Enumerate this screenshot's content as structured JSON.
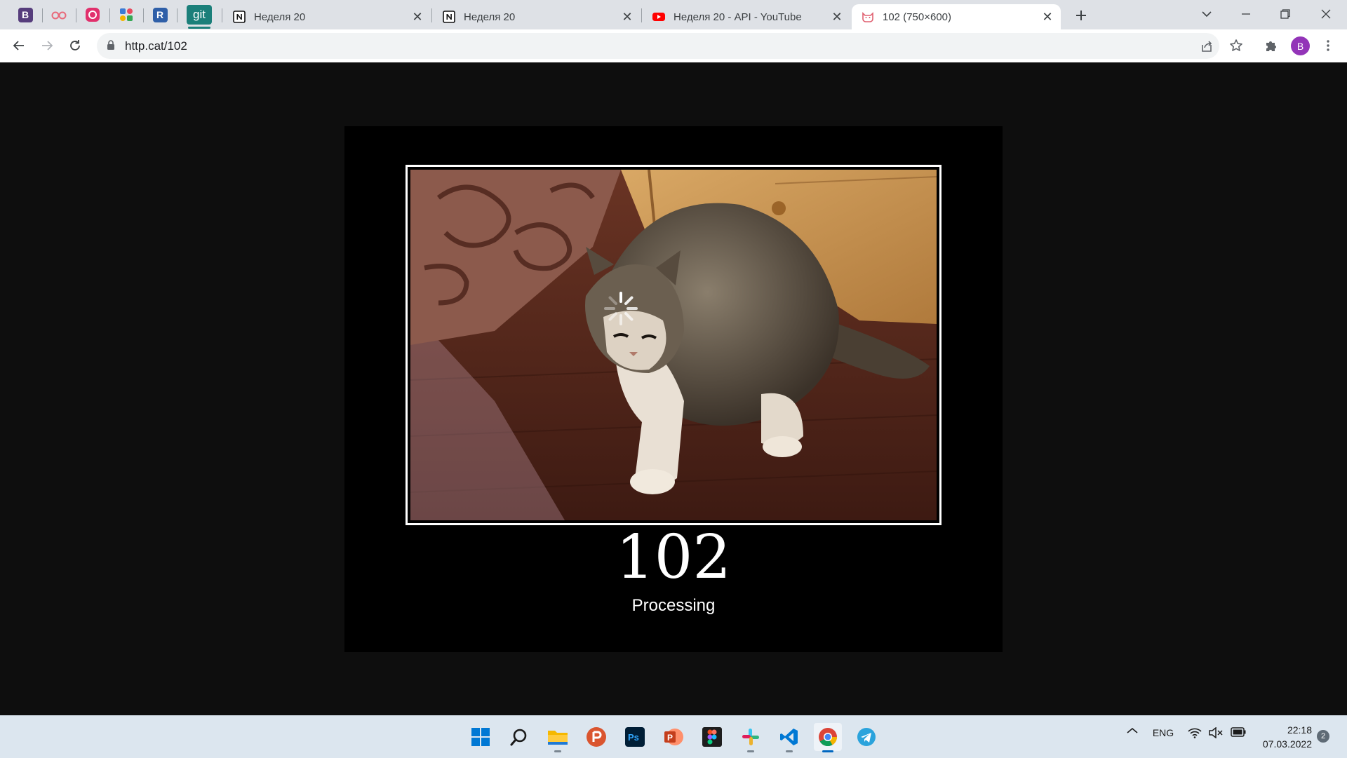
{
  "browser": {
    "pinned_tabs": [
      {
        "label": "B",
        "icon": "bootstrap-icon",
        "color": "#563d7c"
      },
      {
        "label": "",
        "icon": "glasses-icon",
        "color": "#e8697a"
      },
      {
        "label": "",
        "icon": "instagram-style-icon",
        "color": "#e1306c"
      },
      {
        "label": "",
        "icon": "apps-grid-icon",
        "color": "#3b7bd6"
      },
      {
        "label": "R",
        "icon": "r-letter-icon",
        "color": "#2f5fa8"
      },
      {
        "label": "git",
        "icon": "git-icon",
        "color": "#1b7f7a"
      }
    ],
    "tabs": [
      {
        "title": "Неделя 20",
        "icon": "notion-icon",
        "active": false
      },
      {
        "title": "Неделя 20",
        "icon": "notion-icon",
        "active": false
      },
      {
        "title": "Неделя 20 - API - YouTube",
        "icon": "youtube-icon",
        "active": false
      },
      {
        "title": "102 (750×600)",
        "icon": "cat-icon",
        "active": true
      }
    ],
    "url": "http.cat/102",
    "profile_initial": "B"
  },
  "content": {
    "status_code": "102",
    "status_text": "Processing"
  },
  "taskbar": {
    "apps": [
      "windows-start-icon",
      "search-icon",
      "file-explorer-icon",
      "producthunt-icon",
      "photoshop-icon",
      "powerpoint-icon",
      "figma-icon",
      "slack-icon",
      "vscode-icon",
      "chrome-icon",
      "telegram-icon"
    ],
    "language": "ENG",
    "time": "22:18",
    "date": "07.03.2022",
    "notification_count": "2"
  }
}
